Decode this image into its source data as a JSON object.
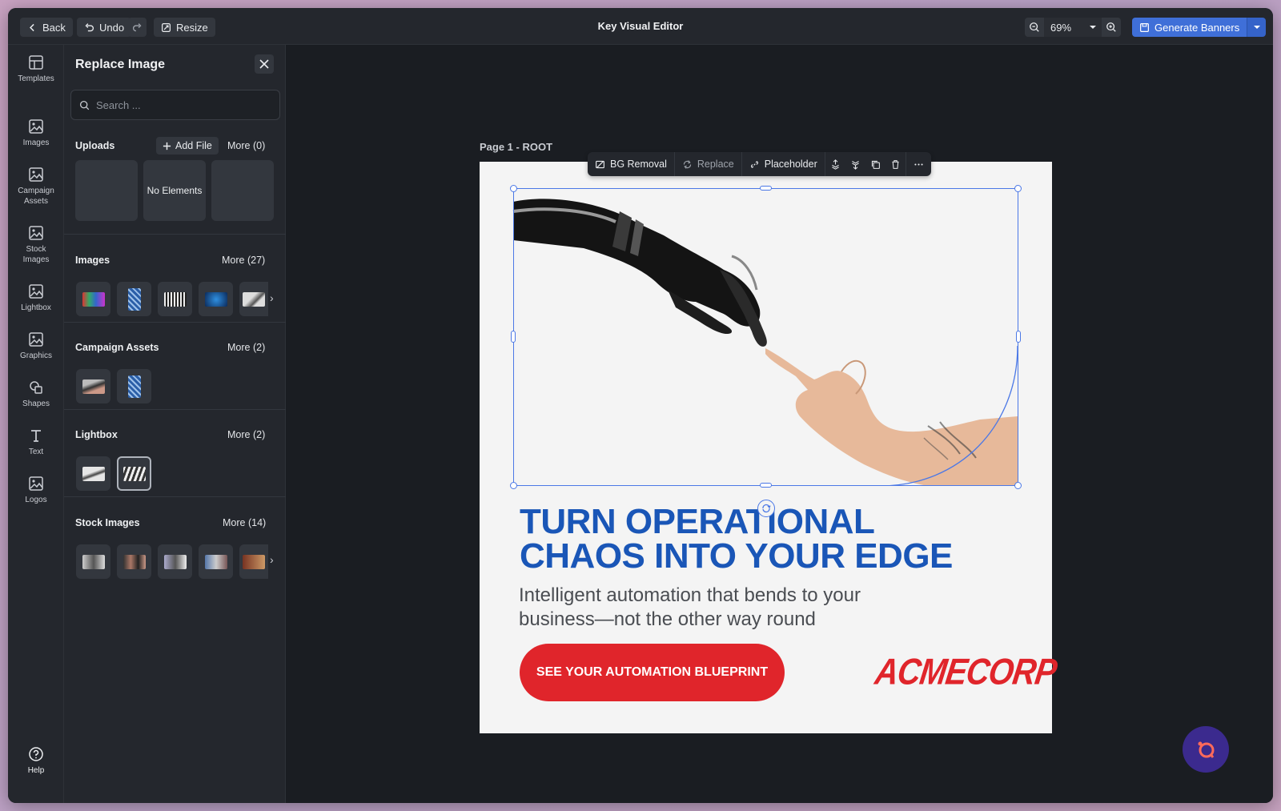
{
  "topbar": {
    "back_label": "Back",
    "undo_label": "Undo",
    "resize_label": "Resize",
    "title": "Key Visual Editor",
    "zoom_value": "69%",
    "generate_label": "Generate Banners"
  },
  "rail": {
    "items": [
      {
        "label": "Templates",
        "icon": "templates-icon"
      },
      {
        "label": "Images",
        "icon": "image-icon"
      },
      {
        "label": "Campaign Assets",
        "icon": "image-icon"
      },
      {
        "label": "Stock Images",
        "icon": "image-icon"
      },
      {
        "label": "Lightbox",
        "icon": "image-icon"
      },
      {
        "label": "Graphics",
        "icon": "image-icon"
      },
      {
        "label": "Shapes",
        "icon": "shapes-icon"
      },
      {
        "label": "Text",
        "icon": "text-icon"
      },
      {
        "label": "Logos",
        "icon": "image-icon"
      }
    ],
    "help_label": "Help"
  },
  "panel": {
    "title": "Replace Image",
    "search_placeholder": "Search ...",
    "uploads": {
      "title": "Uploads",
      "add_label": "Add File",
      "more_label": "More (0)",
      "empty_label": "No Elements"
    },
    "images": {
      "title": "Images",
      "more_label": "More (27)"
    },
    "campaign_assets": {
      "title": "Campaign Assets",
      "more_label": "More (2)"
    },
    "lightbox": {
      "title": "Lightbox",
      "more_label": "More (2)"
    },
    "stock_images": {
      "title": "Stock Images",
      "more_label": "More (14)"
    }
  },
  "canvas": {
    "page_label": "Page 1 - ROOT",
    "toolbar": {
      "bg_removal": "BG Removal",
      "replace": "Replace",
      "placeholder": "Placeholder"
    },
    "banner": {
      "headline_1": "TURN OPERATIONAL",
      "headline_2": "CHAOS INTO YOUR EDGE",
      "sub_1": "Intelligent automation that bends to your",
      "sub_2": "business—not the other way round",
      "cta": "SEE YOUR AUTOMATION BLUEPRINT",
      "logo": "ACMECORP"
    }
  },
  "colors": {
    "accent": "#3f6fd8",
    "headline": "#1a56b7",
    "cta": "#e0252b",
    "selection": "#4b78e6"
  }
}
